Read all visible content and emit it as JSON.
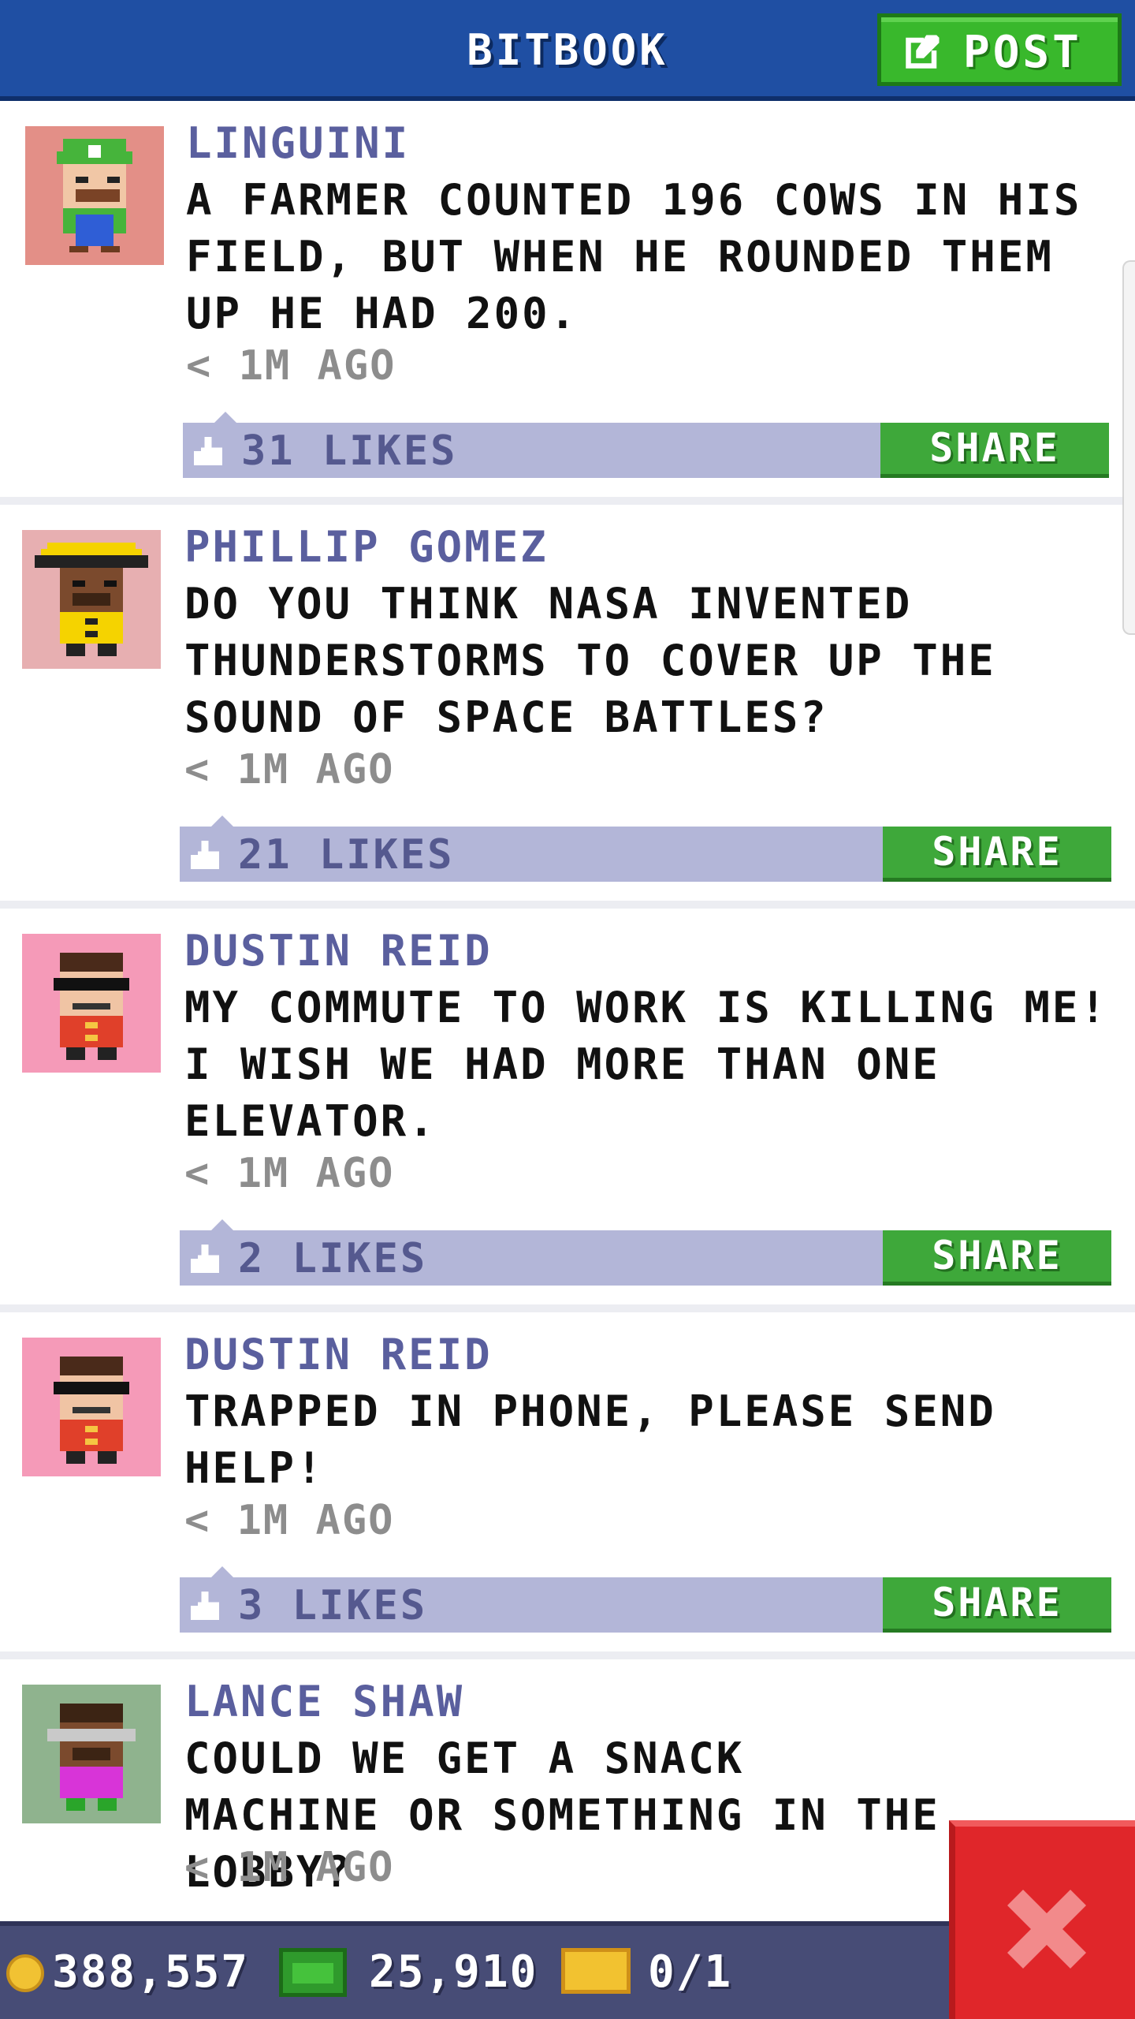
{
  "header": {
    "title": "BITBOOK",
    "post_label": "POST"
  },
  "posts": [
    {
      "name": "LINGUINI",
      "text": "A FARMER COUNTED 196 COWS IN HIS FIELD, BUT WHEN HE ROUNDED THEM UP HE HAD 200.",
      "time": "< 1M AGO",
      "likes": "31 LIKES",
      "share": "SHARE",
      "avatar_bg": "#e38f87"
    },
    {
      "name": "PHILLIP GOMEZ",
      "text": "DO YOU THINK NASA INVENTED THUNDERSTORMS TO COVER UP THE SOUND OF SPACE BATTLES?",
      "time": "< 1M AGO",
      "likes": "21 LIKES",
      "share": "SHARE",
      "avatar_bg": "#e7afb1"
    },
    {
      "name": "DUSTIN REID",
      "text": "MY COMMUTE TO WORK IS KILLING ME! I WISH WE HAD MORE THAN ONE ELEVATOR.",
      "time": "< 1M AGO",
      "likes": "2 LIKES",
      "share": "SHARE",
      "avatar_bg": "#f59ab8"
    },
    {
      "name": "DUSTIN REID",
      "text": "TRAPPED IN PHONE, PLEASE SEND HELP!",
      "time": "< 1M AGO",
      "likes": "3 LIKES",
      "share": "SHARE",
      "avatar_bg": "#f59ab8"
    },
    {
      "name": "LANCE SHAW",
      "text": "COULD WE GET A SNACK MACHINE OR SOMETHING IN THE LOBBY?",
      "time": "< 1M AGO",
      "avatar_bg": "#8fb38e"
    }
  ],
  "status": {
    "coins": "388,557",
    "bux": "25,910",
    "tickets": "0/1"
  },
  "colors": {
    "header": "#1f4fa3",
    "post_button": "#39b82c",
    "likes_bar": "#b3b6d8",
    "share_button": "#3ea83a",
    "status_bar": "#474c76",
    "close_button": "#e0262a"
  }
}
